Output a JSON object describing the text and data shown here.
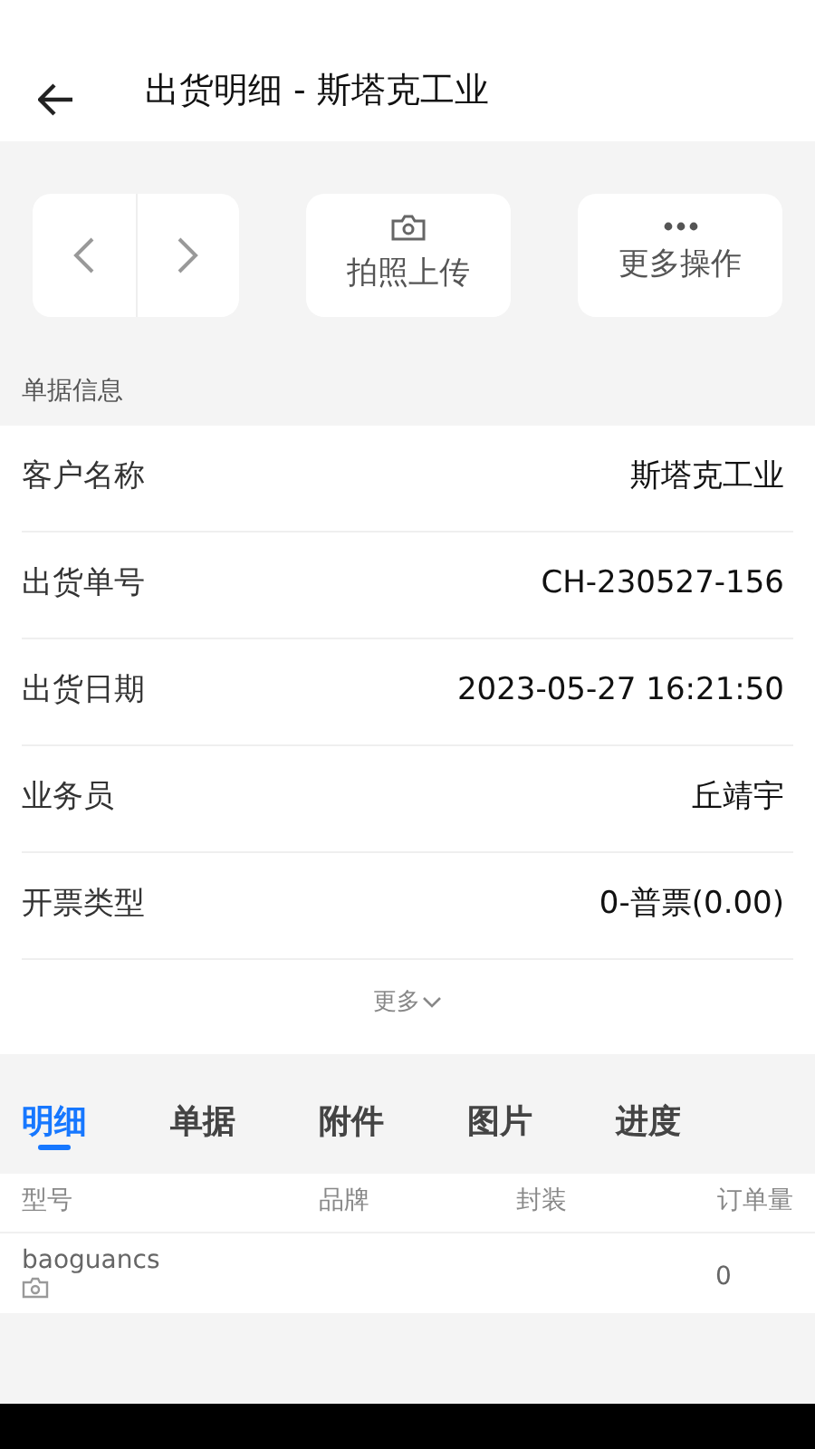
{
  "header": {
    "title": "出货明细 - 斯塔克工业"
  },
  "actions": [
    {
      "kind": "camera",
      "label": "拍照上传"
    },
    {
      "kind": "more",
      "label": "更多操作"
    }
  ],
  "section_title": "单据信息",
  "fields": [
    {
      "label": "客户名称",
      "value": "斯塔克工业"
    },
    {
      "label": "出货单号",
      "value": "CH-230527-156"
    },
    {
      "label": "出货日期",
      "value": "2023-05-27 16:21:50"
    },
    {
      "label": "业务员",
      "value": "丘靖宇"
    },
    {
      "label": "开票类型",
      "value": "0-普票(0.00)"
    }
  ],
  "more_link": "更多",
  "tabs": [
    {
      "label": "明细",
      "selected": true
    },
    {
      "label": "单据",
      "selected": false
    },
    {
      "label": "附件",
      "selected": false
    },
    {
      "label": "图片",
      "selected": false
    },
    {
      "label": "进度",
      "selected": false
    }
  ],
  "table": {
    "columns": [
      "型号",
      "品牌",
      "封装",
      "订单量"
    ],
    "rows": [
      {
        "model": "baoguancs",
        "has_photo": true,
        "brand": "",
        "package": "",
        "quantity": "0"
      }
    ]
  }
}
